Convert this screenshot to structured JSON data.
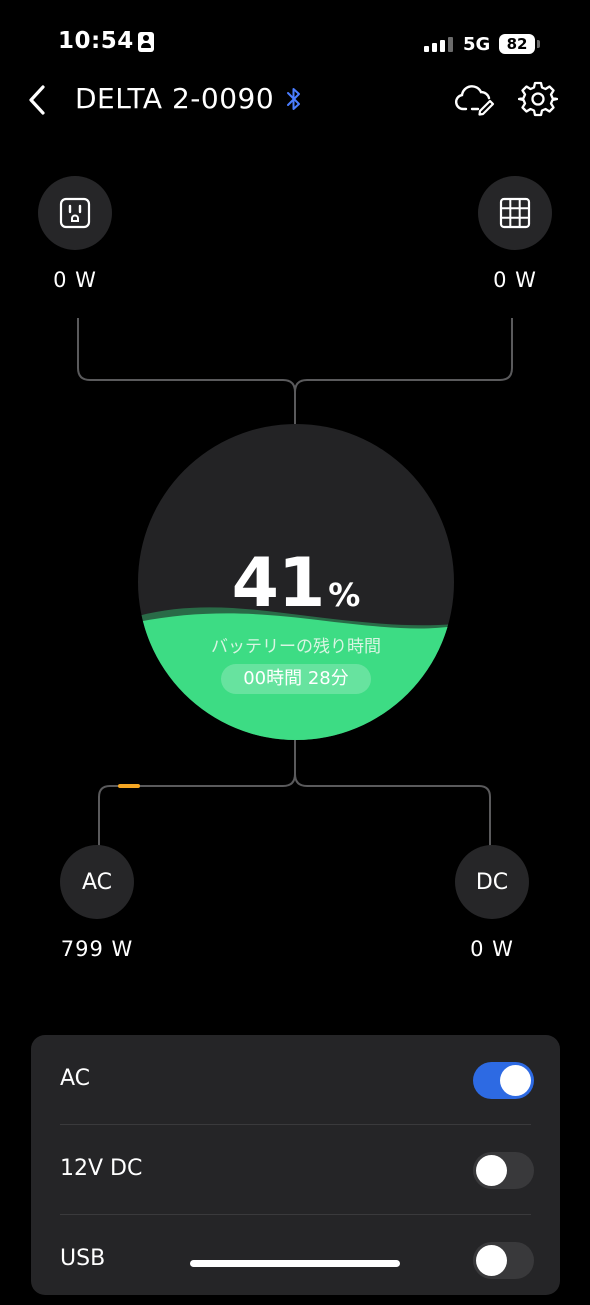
{
  "status_bar": {
    "time": "10:54",
    "network": "5G",
    "battery_level": "82"
  },
  "header": {
    "title": "DELTA 2-0090",
    "bluetooth_icon": "bluetooth-icon",
    "cloud_icon": "cloud-edit-icon",
    "settings_icon": "gear-icon"
  },
  "inputs": {
    "ac_input": {
      "icon": "ac-outlet-icon",
      "watts": "0 W"
    },
    "solar_input": {
      "icon": "solar-panel-icon",
      "watts": "0 W"
    }
  },
  "battery": {
    "percent": "41",
    "unit": "%",
    "remaining_label": "バッテリーの残り時間",
    "remaining_time": "00時間 28分",
    "fill_color": "#3ddc84"
  },
  "outputs": {
    "ac": {
      "label": "AC",
      "watts": "799 W"
    },
    "dc": {
      "label": "DC",
      "watts": "0 W"
    }
  },
  "output_panel": {
    "rows": [
      {
        "label": "AC",
        "enabled": true
      },
      {
        "label": "12V DC",
        "enabled": false
      },
      {
        "label": "USB",
        "enabled": false
      }
    ]
  },
  "colors": {
    "accent_blue": "#2d6ae3",
    "flow_active": "#f5a623",
    "bluetooth": "#4a7dff"
  }
}
